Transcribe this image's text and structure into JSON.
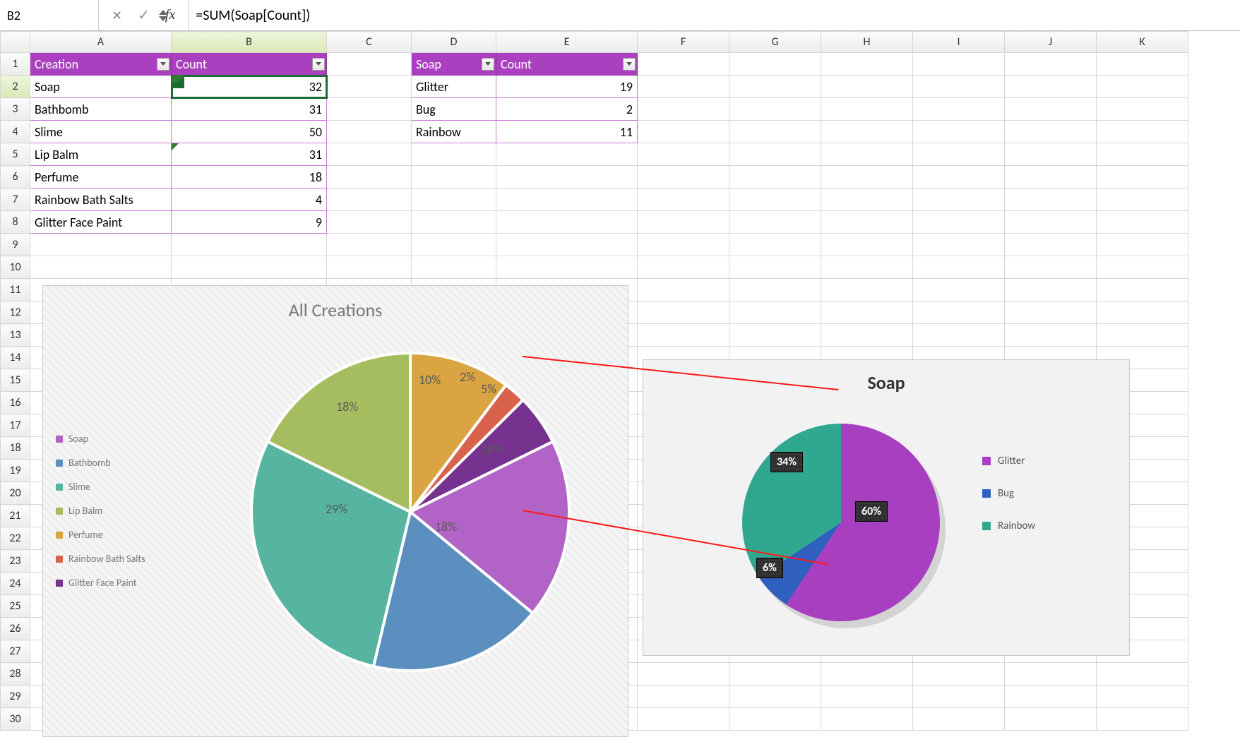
{
  "formula_bar": {
    "cell_ref": "B2",
    "fx_label": "fx",
    "formula": "=SUM(Soap[Count])"
  },
  "columns": [
    "A",
    "B",
    "C",
    "D",
    "E",
    "F",
    "G",
    "H",
    "I",
    "J",
    "K"
  ],
  "row_count": 30,
  "table1": {
    "headers": [
      "Creation",
      "Count"
    ],
    "rows": [
      {
        "creation": "Soap",
        "count": 32
      },
      {
        "creation": "Bathbomb",
        "count": 31
      },
      {
        "creation": "Slime",
        "count": 50
      },
      {
        "creation": "Lip Balm",
        "count": 31
      },
      {
        "creation": "Perfume",
        "count": 18
      },
      {
        "creation": "Rainbow Bath Salts",
        "count": 4
      },
      {
        "creation": "Glitter Face Paint",
        "count": 9
      }
    ]
  },
  "table2": {
    "headers": [
      "Soap",
      "Count"
    ],
    "rows": [
      {
        "soap": "Glitter",
        "count": 19
      },
      {
        "soap": "Bug",
        "count": 2
      },
      {
        "soap": "Rainbow",
        "count": 11
      }
    ]
  },
  "chart_data": [
    {
      "type": "pie",
      "title": "All Creations",
      "series": [
        {
          "name": "Soap",
          "value": 32,
          "pct": "18%",
          "color": "#b164c5"
        },
        {
          "name": "Bathbomb",
          "value": 31,
          "pct": "18%",
          "color": "#5b8fc0"
        },
        {
          "name": "Slime",
          "value": 50,
          "pct": "29%",
          "color": "#57b4a1"
        },
        {
          "name": "Lip Balm",
          "value": 31,
          "pct": "18%",
          "color": "#a6bd5f"
        },
        {
          "name": "Perfume",
          "value": 18,
          "pct": "10%",
          "color": "#d9a441"
        },
        {
          "name": "Rainbow Bath Salts",
          "value": 4,
          "pct": "2%",
          "color": "#d9624d"
        },
        {
          "name": "Glitter Face Paint",
          "value": 9,
          "pct": "5%",
          "color": "#77328f"
        }
      ],
      "legend_position": "left"
    },
    {
      "type": "pie",
      "title": "Soap",
      "series": [
        {
          "name": "Glitter",
          "value": 19,
          "pct": "60%",
          "color": "#a83fc1"
        },
        {
          "name": "Bug",
          "value": 2,
          "pct": "6%",
          "color": "#2f5fbf"
        },
        {
          "name": "Rainbow",
          "value": 11,
          "pct": "34%",
          "color": "#2fa88f"
        }
      ],
      "legend_position": "right"
    }
  ]
}
